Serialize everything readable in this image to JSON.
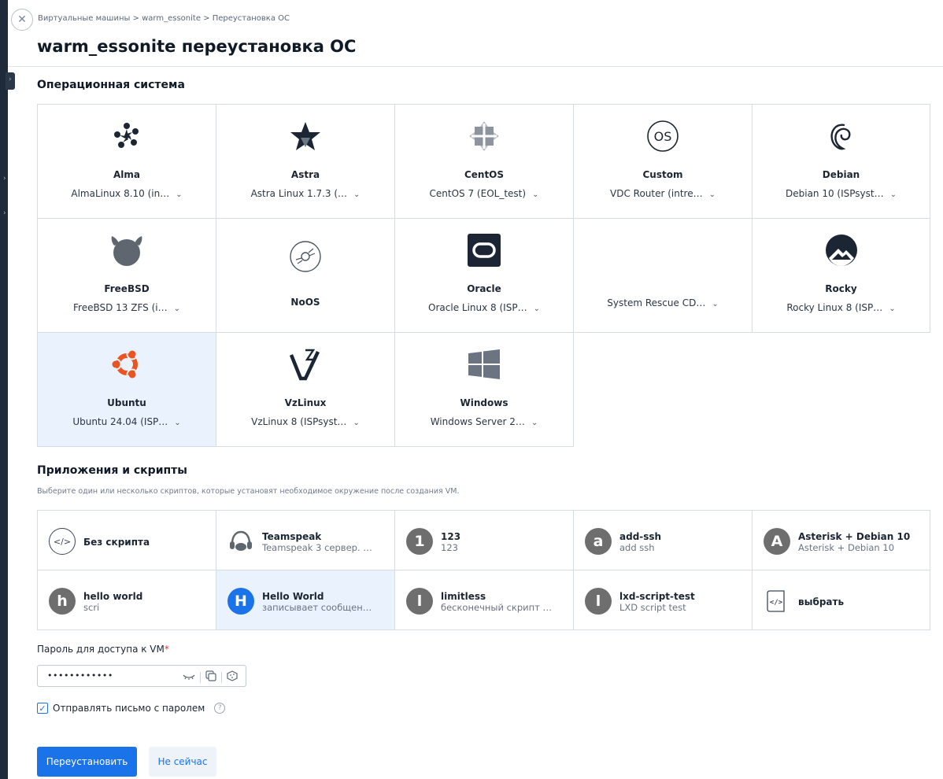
{
  "breadcrumb": "Виртуальные машины > warm_essonite > Переустановка ОС",
  "page_title": "warm_essonite переустановка ОС",
  "os_section": {
    "heading": "Операционная система",
    "items": [
      {
        "name": "Alma",
        "version": "AlmaLinux 8.10 (in…",
        "icon": "alma-icon"
      },
      {
        "name": "Astra",
        "version": "Astra Linux 1.7.3 (…",
        "icon": "astra-icon"
      },
      {
        "name": "CentOS",
        "version": "CentOS 7 (EOL_test)",
        "icon": "centos-icon"
      },
      {
        "name": "Custom",
        "version": "VDC Router (intre…",
        "icon": "custom-os-icon"
      },
      {
        "name": "Debian",
        "version": "Debian 10 (ISPsyst…",
        "icon": "debian-icon"
      },
      {
        "name": "FreeBSD",
        "version": "FreeBSD 13 ZFS (i…",
        "icon": "freebsd-icon"
      },
      {
        "name": "NoOS",
        "version": "",
        "icon": "disc-icon"
      },
      {
        "name": "Oracle",
        "version": "Oracle Linux 8 (ISP…",
        "icon": "oracle-icon"
      },
      {
        "name": "",
        "version": "System Rescue CD…",
        "icon": ""
      },
      {
        "name": "Rocky",
        "version": "Rocky Linux 8 (ISP…",
        "icon": "rocky-icon"
      },
      {
        "name": "Ubuntu",
        "version": "Ubuntu 24.04 (ISP…",
        "icon": "ubuntu-icon",
        "selected": true
      },
      {
        "name": "VzLinux",
        "version": "VzLinux 8 (ISPsyst…",
        "icon": "vzlinux-icon"
      },
      {
        "name": "Windows",
        "version": "Windows Server 2…",
        "icon": "windows-icon"
      }
    ]
  },
  "scripts_section": {
    "heading": "Приложения и скрипты",
    "hint": "Выберите один или несколько скриптов, которые установят необходимое окружение после создания VM.",
    "items": [
      {
        "title": "Без скрипта",
        "desc": "",
        "letter": "</>",
        "icon": "code-icon"
      },
      {
        "title": "Teamspeak",
        "desc": "Teamspeak 3 сервер. …",
        "letter": "",
        "icon": "teamspeak-icon"
      },
      {
        "title": "123",
        "desc": "123",
        "letter": "1"
      },
      {
        "title": "add-ssh",
        "desc": "add ssh",
        "letter": "a"
      },
      {
        "title": "Asterisk + Debian 10",
        "desc": "Asterisk + Debian 10",
        "letter": "A"
      },
      {
        "title": "hello world",
        "desc": "scri",
        "letter": "h"
      },
      {
        "title": "Hello World",
        "desc": "записывает сообщен…",
        "letter": "H",
        "selected": true
      },
      {
        "title": "limitless",
        "desc": "бесконечный скрипт …",
        "letter": "l"
      },
      {
        "title": "lxd-script-test",
        "desc": "LXD script test",
        "letter": "l"
      },
      {
        "title": "выбрать",
        "desc": "",
        "letter": "",
        "icon": "script-file-icon"
      }
    ]
  },
  "password": {
    "label": "Пароль для доступа к VM",
    "required_mark": "*",
    "value": "••••••••••••"
  },
  "send_email": {
    "label": "Отправлять письмо с паролем",
    "checked": true,
    "help": "?"
  },
  "actions": {
    "primary": "Переустановить",
    "secondary": "Не сейчас"
  },
  "colors": {
    "accent": "#1a73e8",
    "selected_bg": "#eaf2fd",
    "border": "#d6dce4"
  }
}
